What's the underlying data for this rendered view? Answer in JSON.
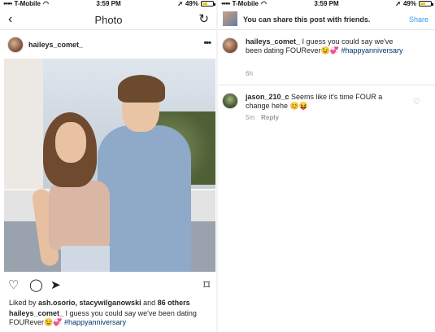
{
  "status_left": {
    "carrier": "T-Mobile",
    "time": "3:59 PM",
    "battery": "49%"
  },
  "status_right": {
    "carrier": "T-Mobile",
    "time": "3:59 PM",
    "battery": "49%"
  },
  "left": {
    "nav": {
      "title": "Photo",
      "back_icon": "‹",
      "refresh_icon": "↻"
    },
    "post": {
      "username": "haileys_comet_",
      "more": "•••",
      "likes_prefix": "Liked by ",
      "likes_users": "ash.osorio, stacywilganowski",
      "likes_and": " and ",
      "likes_others": "86 others",
      "caption_user": "haileys_comet_",
      "caption_text": " I guess you could say we've been dating FOURever",
      "caption_emoji": "😉💞",
      "hashtag": "#happyanniversary"
    },
    "action_icons": {
      "like": "♡",
      "comment": "◯",
      "share": "➤",
      "save": "⌑"
    }
  },
  "right": {
    "share_bar": {
      "message": "You can share this post with friends.",
      "action": "Share"
    },
    "caption": {
      "username": "haileys_comet_",
      "text": " I guess you could say we've been dating FOURever",
      "emoji": "😉💞",
      "hashtag": "#happyanniversary",
      "time": "6h"
    },
    "comments": [
      {
        "username": "jason_210_c",
        "text": " Seems like it's time FOUR a change hehe ",
        "emoji": "😊😝",
        "time": "5m",
        "reply": "Reply"
      }
    ]
  },
  "colors": {
    "link": "#3897f0",
    "hashtag": "#003569",
    "battery": "#f5c518"
  }
}
